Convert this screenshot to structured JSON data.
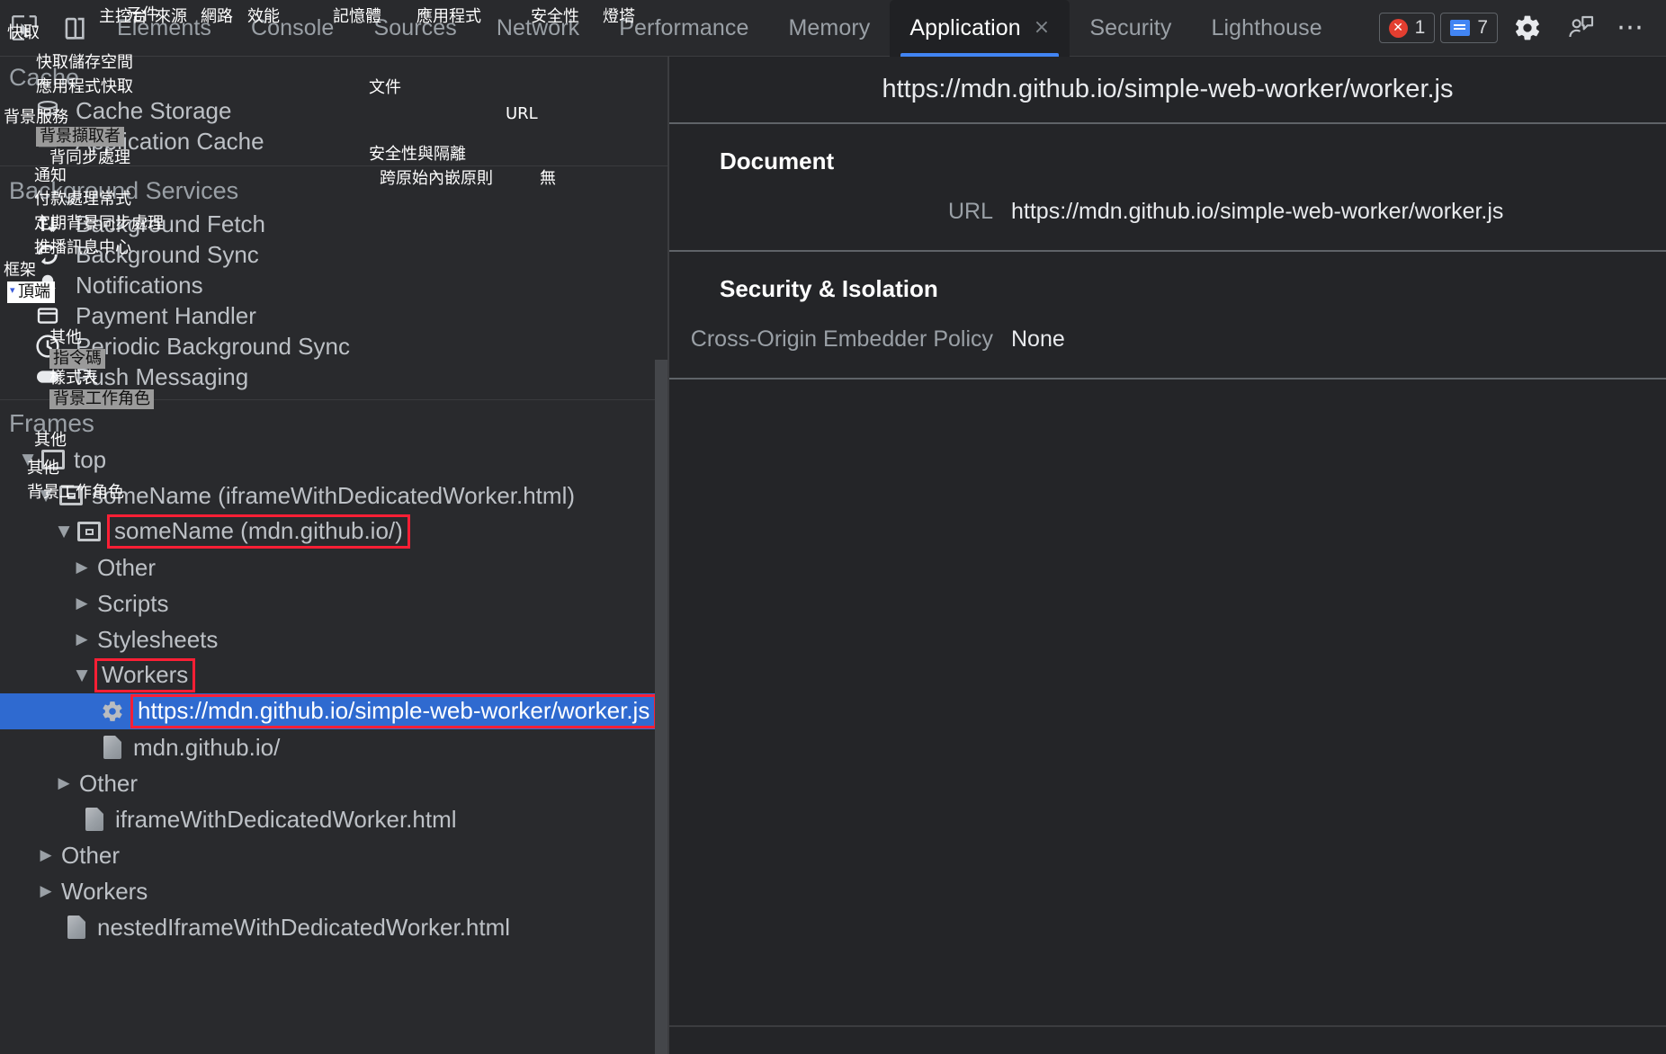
{
  "toolbar": {
    "inspect_icon": "inspect-cursor-icon",
    "device_icon": "device-toolbar-icon",
    "tabs": [
      {
        "label": "Elements",
        "active": false
      },
      {
        "label": "Console",
        "active": false
      },
      {
        "label": "Sources",
        "active": false
      },
      {
        "label": "Network",
        "active": false
      },
      {
        "label": "Performance",
        "active": false
      },
      {
        "label": "Memory",
        "active": false
      },
      {
        "label": "Application",
        "active": true,
        "close": "×"
      },
      {
        "label": "Security",
        "active": false
      },
      {
        "label": "Lighthouse",
        "active": false
      }
    ],
    "error_count": "1",
    "message_count": "7",
    "settings_icon": "gear-icon",
    "feedback_icon": "feedback-person-icon",
    "more_icon": "three-dots-icon",
    "accent_blue": "#4285f4",
    "error_red": "#e33e30"
  },
  "sidebar": {
    "cache_group": {
      "title": "Cache",
      "items": [
        {
          "label": "Cache Storage",
          "icon": "cache-storage-icon"
        },
        {
          "label": "Application Cache",
          "icon": "application-cache-icon"
        }
      ]
    },
    "background_group": {
      "title": "Background Services",
      "items": [
        {
          "label": "Background Fetch",
          "icon": "background-fetch-icon"
        },
        {
          "label": "Background Sync",
          "icon": "background-sync-icon"
        },
        {
          "label": "Notifications",
          "icon": "bell-icon"
        },
        {
          "label": "Payment Handler",
          "icon": "payment-handler-icon"
        },
        {
          "label": "Periodic Background Sync",
          "icon": "clock-icon"
        },
        {
          "label": "Push Messaging",
          "icon": "push-messaging-icon"
        }
      ]
    },
    "frames_group": {
      "title": "Frames",
      "tree": [
        {
          "label": "top",
          "icon": "frame-icon",
          "depth": 0,
          "caret": "open",
          "highlight": false,
          "selected": false
        },
        {
          "label": "someName (iframeWithDedicatedWorker.html)",
          "icon": "iframe-icon",
          "depth": 1,
          "caret": "open",
          "highlight": false,
          "selected": false
        },
        {
          "label": "someName (mdn.github.io/)",
          "icon": "iframe-icon",
          "depth": 2,
          "caret": "open",
          "highlight": true,
          "selected": false
        },
        {
          "label": "Other",
          "icon": "none",
          "depth": 3,
          "caret": "closed",
          "highlight": false,
          "selected": false
        },
        {
          "label": "Scripts",
          "icon": "none",
          "depth": 3,
          "caret": "closed",
          "highlight": false,
          "selected": false
        },
        {
          "label": "Stylesheets",
          "icon": "none",
          "depth": 3,
          "caret": "closed",
          "highlight": false,
          "selected": false
        },
        {
          "label": "Workers",
          "icon": "none",
          "depth": 3,
          "caret": "open",
          "highlight": true,
          "selected": false
        },
        {
          "label": "https://mdn.github.io/simple-web-worker/worker.js",
          "icon": "gear-icon",
          "depth": 4,
          "caret": "none",
          "highlight": true,
          "selected": true
        },
        {
          "label": "mdn.github.io/",
          "icon": "doc-icon",
          "depth": 4,
          "caret": "none",
          "highlight": false,
          "selected": false
        },
        {
          "label": "Other",
          "icon": "none",
          "depth": 2,
          "caret": "closed",
          "highlight": false,
          "selected": false
        },
        {
          "label": "iframeWithDedicatedWorker.html",
          "icon": "doc-icon",
          "depth": 3,
          "caret": "none",
          "highlight": false,
          "selected": false
        },
        {
          "label": "Other",
          "icon": "none",
          "depth": 1,
          "caret": "closed",
          "highlight": false,
          "selected": false
        },
        {
          "label": "Workers",
          "icon": "none",
          "depth": 1,
          "caret": "closed",
          "highlight": false,
          "selected": false
        },
        {
          "label": "nestedIframeWithDedicatedWorker.html",
          "icon": "doc-icon",
          "depth": 2,
          "caret": "none",
          "highlight": false,
          "selected": false
        }
      ]
    },
    "highlight_color": "#fc1f35",
    "selection_color": "#2f6ad0"
  },
  "detail": {
    "header_url": "https://mdn.github.io/simple-web-worker/worker.js",
    "document_section": {
      "title": "Document",
      "rows": [
        {
          "key": "URL",
          "value": "https://mdn.github.io/simple-web-worker/worker.js"
        }
      ]
    },
    "security_section": {
      "title": "Security & Isolation",
      "rows": [
        {
          "key": "Cross-Origin Embedder Policy",
          "value": "None"
        }
      ]
    }
  },
  "overlay_translations": {
    "inspect": "快取",
    "elements": "元件",
    "console": "主控台",
    "sources": "來源",
    "network": "網路",
    "performance": "效能",
    "memory": "記憶體",
    "application": "應用程式",
    "security": "安全性",
    "lighthouse": "燈塔",
    "cache_storage": "快取儲存空間",
    "application_cache": "應用程式快取",
    "background_services": "背景服務",
    "background_fetch": "背景擷取者",
    "background_sync": "背同步處理",
    "notifications": "通知",
    "payment_handler": "付款處理常式",
    "periodic_background_sync": "定期背景同步處理",
    "push_messaging": "推播訊息中心",
    "frames": "框架",
    "top": "頂端",
    "other": "其他",
    "scripts": "指令碼",
    "stylesheets": "樣式表",
    "workers": "背景工作角色",
    "document": "文件",
    "url": "URL",
    "security_isolation": "安全性與隔離",
    "coep": "跨原始內嵌原則",
    "none": "無"
  }
}
